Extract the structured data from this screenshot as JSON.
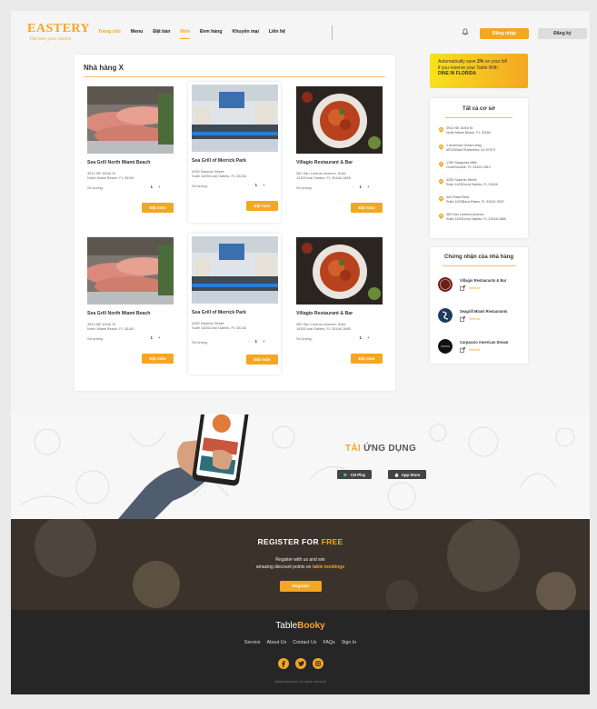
{
  "header": {
    "logo": "EASTERY",
    "logo_sub": "The best your choice",
    "nav": [
      "Trang chủ",
      "Menu",
      "Đặt bàn",
      "Món",
      "Đơn hàng",
      "Khuyến mại",
      "Liên hệ"
    ],
    "login": "Đăng nhập",
    "register": "Đăng ký"
  },
  "main": {
    "title": "Nhà hàng X",
    "qty_label": "Số lượng:",
    "qty_value": "1",
    "order_label": "Đặt món",
    "cards": [
      {
        "name": "Sea Grill North Miami Beach",
        "addr1": "3913 NE 163rd St",
        "addr2": "North Miami Beach, FL 33160"
      },
      {
        "name": "Sea Grill of Merrick Park",
        "addr1": "4250 Salzedo Street,",
        "addr2": "Suite 1425Coral Gables, FL 33146"
      },
      {
        "name": "Villagio Restaurant & Bar",
        "addr1": "360 San Lorenzo Avenue, Suite",
        "addr2": "1430Coral Gables, FL 33146-1865"
      },
      {
        "name": "Sea Grill North Miami Beach",
        "addr1": "3913 NE 163rd St",
        "addr2": "North Miami Beach, FL 33160"
      },
      {
        "name": "Sea Grill of Merrick Park",
        "addr1": "4250 Salzedo Street,",
        "addr2": "Suite 1425Coral Gables, FL 33146"
      },
      {
        "name": "Villagio Restaurant & Bar",
        "addr1": "360 San Lorenzo Avenue, Suite",
        "addr2": "1430Coral Gables, FL 33146-1865"
      }
    ]
  },
  "promo": {
    "line1": "Automatically save",
    "pct": "2%",
    "line1b": "on your bill",
    "line2": "if you reserve your Table With",
    "line3": "DINE IN FLORIDA"
  },
  "locations": {
    "title": "Tất cả cơ sở",
    "items": [
      {
        "l1": "3913 NE 163rd St",
        "l2": "North Miami Beach, FL 33160"
      },
      {
        "l1": "1 American Dream Way,",
        "l2": "#F225East Rutherford, NJ 07073"
      },
      {
        "l1": "1760 Sawgrass Mills",
        "l2": "CircleSunrise, FL 33323-3912"
      },
      {
        "l1": "4250 Salzedo Street,",
        "l2": "Suite 1425Coral Gables, FL 33146"
      },
      {
        "l1": "344 Plaza Real,",
        "l2": "Suite 1433Boca Raton, FL 33432-3937"
      },
      {
        "l1": "360 San Lorenzo Avenue,",
        "l2": "Suite 1430Coral Gables, FL 33146-1865"
      }
    ]
  },
  "certs": {
    "title": "Chứng nhận của nhà hàng",
    "link_label": "Website",
    "items": [
      {
        "name": "Villagio Restaurants & Bar"
      },
      {
        "name": "Seagrill Miami Restaurants"
      },
      {
        "name": "Carpaccio American Dream"
      }
    ]
  },
  "app": {
    "title_orange": "TẢI",
    "title_rest": "ỨNG DỤNG",
    "ch_play": "CH Play",
    "app_store": "App Store"
  },
  "register": {
    "title": "REGISTER FOR",
    "title_orange": "FREE",
    "line1": "Register with us and win",
    "line2": "amazing discount points on",
    "line2_bold": "table bookings",
    "button": "Register"
  },
  "footer": {
    "brand_light": "Table",
    "brand_bold": "Booky",
    "links": [
      "Service",
      "About Us",
      "Contact Us",
      "FAQs",
      "Sign In"
    ],
    "copyright": "tablebooky.com | All rights reserved"
  },
  "colors": {
    "accent": "#f5a623",
    "footer_bg": "#262626"
  }
}
